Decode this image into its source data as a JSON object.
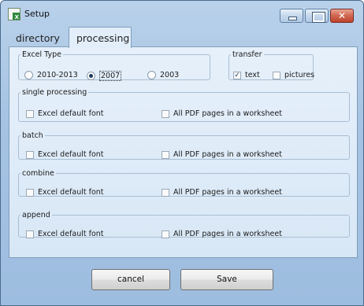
{
  "window": {
    "title": "Setup",
    "icon": "excel-app-icon",
    "close_glyph": "✕"
  },
  "tabs": [
    {
      "label": "directory",
      "selected": false
    },
    {
      "label": "processing",
      "selected": true
    }
  ],
  "excel_type": {
    "legend": "Excel Type",
    "options": [
      "2010-2013",
      "2007",
      "2003"
    ],
    "selected": "2007"
  },
  "transfer": {
    "legend": "transfer",
    "text": {
      "label": "text",
      "checked": true
    },
    "pictures": {
      "label": "pictures",
      "checked": false
    }
  },
  "groups": [
    {
      "legend": "single processing",
      "excel_default_font": "Excel default font",
      "all_pdf_pages": "All PDF pages in a worksheet"
    },
    {
      "legend": "batch",
      "excel_default_font": "Excel default font",
      "all_pdf_pages": "All PDF pages in a worksheet"
    },
    {
      "legend": "combine",
      "excel_default_font": "Excel default font",
      "all_pdf_pages": "All PDF pages in a worksheet"
    },
    {
      "legend": "append",
      "excel_default_font": "Excel default font",
      "all_pdf_pages": "All PDF pages in a worksheet"
    }
  ],
  "buttons": {
    "cancel": "cancel",
    "save": "Save"
  },
  "check_glyph": "✓"
}
